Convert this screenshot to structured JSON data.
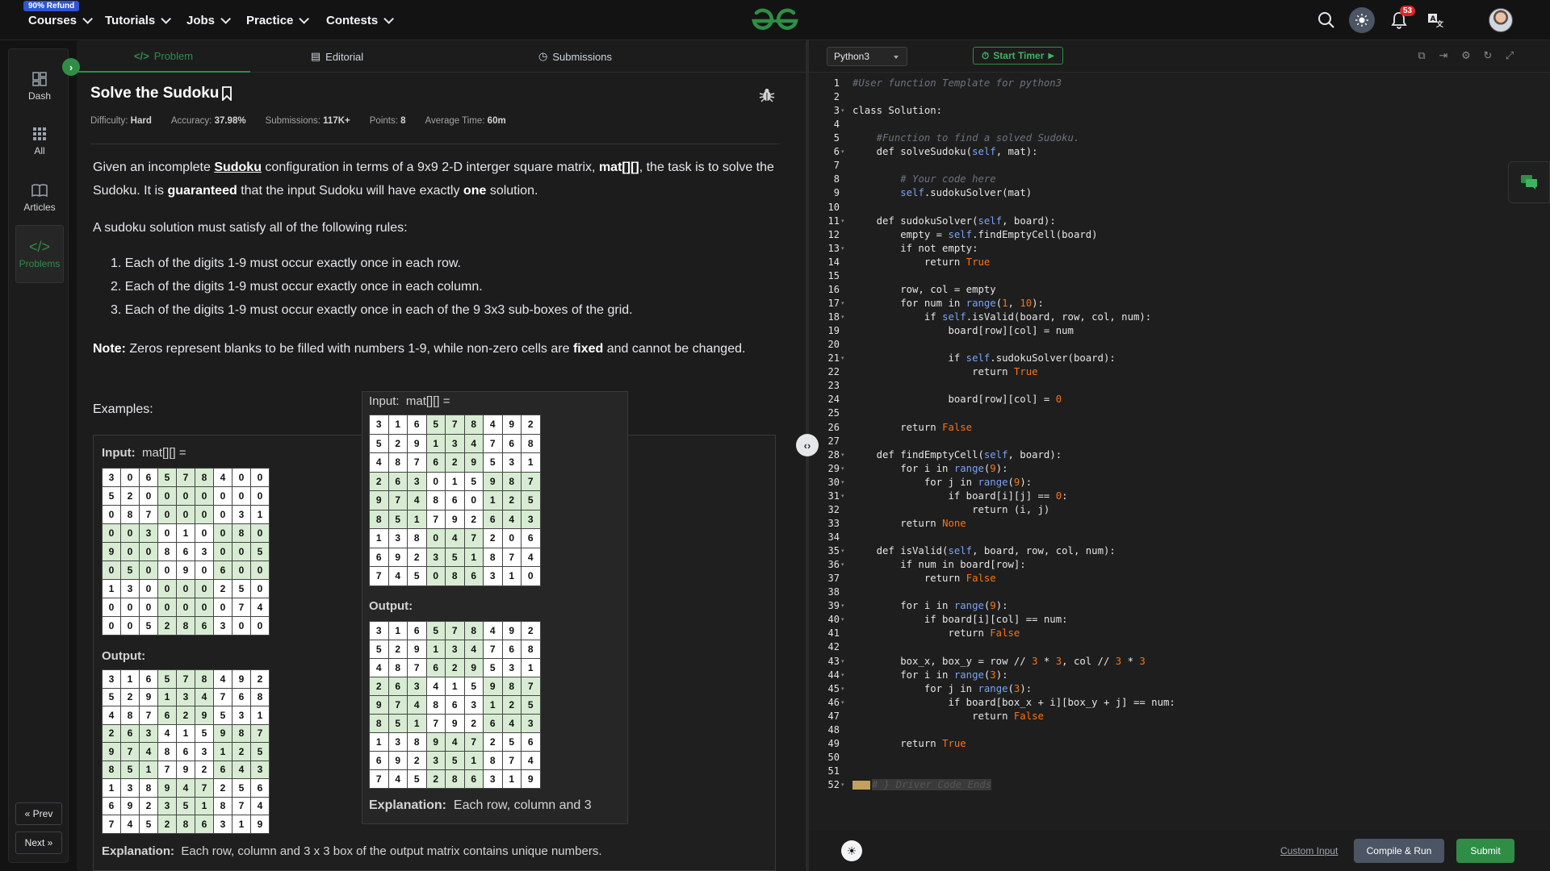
{
  "nav": {
    "refund_badge": "90% Refund",
    "items": [
      "Courses",
      "Tutorials",
      "Jobs",
      "Practice",
      "Contests"
    ],
    "notification_count": "53"
  },
  "sidebar": {
    "items": [
      "Dash",
      "All",
      "Articles",
      "Problems"
    ],
    "prev": "« Prev",
    "next": "Next »"
  },
  "tabs": [
    "Problem",
    "Editorial",
    "Submissions"
  ],
  "problem": {
    "title": "Solve the Sudoku",
    "difficulty_label": "Difficulty:",
    "difficulty": "Hard",
    "accuracy_label": "Accuracy:",
    "accuracy": "37.98%",
    "submissions_label": "Submissions:",
    "submissions": "117K+",
    "points_label": "Points:",
    "points": "8",
    "avgtime_label": "Average Time:",
    "avgtime": "60m",
    "p1_a": "Given an incomplete ",
    "p1_link": "Sudoku",
    "p1_b": " configuration in terms of a 9x9  2-D interger square matrix, ",
    "p1_mat": "mat[][]",
    "p1_c": ", the task is to solve the Sudoku. It is ",
    "p1_guaranteed": "guaranteed",
    "p1_d": " that the input Sudoku will have exactly ",
    "p1_one": "one",
    "p1_e": " solution.",
    "p2": "A sudoku solution must satisfy all of the following rules:",
    "rules": [
      "1. Each of the digits 1-9 must occur exactly once in each row.",
      "2. Each of the digits 1-9 must occur exactly once in each column.",
      "3. Each of the digits 1-9 must occur exactly once in each of the 9 3x3 sub-boxes of the grid."
    ],
    "note_label": "Note:",
    "note_a": " Zeros represent blanks to be filled with numbers 1-9, while non-zero cells are ",
    "note_fixed": "fixed",
    "note_b": " and cannot be changed.",
    "examples": "Examples:",
    "input_label": "Input:",
    "input_var": "mat[][] =",
    "output_label": "Output:",
    "explanation_label": "Explanation:",
    "explanation": "Each row, column and 3 x 3 box of the output matrix contains unique numbers.",
    "explanation_popup": "Each row, column and 3"
  },
  "input_grid": [
    [
      3,
      0,
      6,
      5,
      7,
      8,
      4,
      0,
      0
    ],
    [
      5,
      2,
      0,
      0,
      0,
      0,
      0,
      0,
      0
    ],
    [
      0,
      8,
      7,
      0,
      0,
      0,
      0,
      3,
      1
    ],
    [
      0,
      0,
      3,
      0,
      1,
      0,
      0,
      8,
      0
    ],
    [
      9,
      0,
      0,
      8,
      6,
      3,
      0,
      0,
      5
    ],
    [
      0,
      5,
      0,
      0,
      9,
      0,
      6,
      0,
      0
    ],
    [
      1,
      3,
      0,
      0,
      0,
      0,
      2,
      5,
      0
    ],
    [
      0,
      0,
      0,
      0,
      0,
      0,
      0,
      7,
      4
    ],
    [
      0,
      0,
      5,
      2,
      8,
      6,
      3,
      0,
      0
    ]
  ],
  "output_grid": [
    [
      3,
      1,
      6,
      5,
      7,
      8,
      4,
      9,
      2
    ],
    [
      5,
      2,
      9,
      1,
      3,
      4,
      7,
      6,
      8
    ],
    [
      4,
      8,
      7,
      6,
      2,
      9,
      5,
      3,
      1
    ],
    [
      2,
      6,
      3,
      4,
      1,
      5,
      9,
      8,
      7
    ],
    [
      9,
      7,
      4,
      8,
      6,
      3,
      1,
      2,
      5
    ],
    [
      8,
      5,
      1,
      7,
      9,
      2,
      6,
      4,
      3
    ],
    [
      1,
      3,
      8,
      9,
      4,
      7,
      2,
      5,
      6
    ],
    [
      6,
      9,
      2,
      3,
      5,
      1,
      8,
      7,
      4
    ],
    [
      7,
      4,
      5,
      2,
      8,
      6,
      3,
      1,
      9
    ]
  ],
  "popup_input_grid": [
    [
      3,
      1,
      6,
      5,
      7,
      8,
      4,
      9,
      2
    ],
    [
      5,
      2,
      9,
      1,
      3,
      4,
      7,
      6,
      8
    ],
    [
      4,
      8,
      7,
      6,
      2,
      9,
      5,
      3,
      1
    ],
    [
      2,
      6,
      3,
      0,
      1,
      5,
      9,
      8,
      7
    ],
    [
      9,
      7,
      4,
      8,
      6,
      0,
      1,
      2,
      5
    ],
    [
      8,
      5,
      1,
      7,
      9,
      2,
      6,
      4,
      3
    ],
    [
      1,
      3,
      8,
      0,
      4,
      7,
      2,
      0,
      6
    ],
    [
      6,
      9,
      2,
      3,
      5,
      1,
      8,
      7,
      4
    ],
    [
      7,
      4,
      5,
      0,
      8,
      6,
      3,
      1,
      0
    ]
  ],
  "editor": {
    "language": "Python3",
    "timer": "Start Timer",
    "custom_input": "Custom Input",
    "compile": "Compile & Run",
    "submit": "Submit",
    "lines": [
      "#User function Template for python3",
      "",
      "class Solution:",
      "",
      "    #Function to find a solved Sudoku.",
      "    def solveSudoku(self, mat):",
      "",
      "        # Your code here",
      "        self.sudokuSolver(mat)",
      "",
      "    def sudokuSolver(self, board):",
      "        empty = self.findEmptyCell(board)",
      "        if not empty:",
      "            return True",
      "",
      "        row, col = empty",
      "        for num in range(1, 10):",
      "            if self.isValid(board, row, col, num):",
      "                board[row][col] = num",
      "",
      "                if self.sudokuSolver(board):",
      "                    return True",
      "",
      "                board[row][col] = 0",
      "",
      "        return False",
      "",
      "    def findEmptyCell(self, board):",
      "        for i in range(9):",
      "            for j in range(9):",
      "                if board[i][j] == 0:",
      "                    return (i, j)",
      "        return None",
      "",
      "    def isValid(self, board, row, col, num):",
      "        if num in board[row]:",
      "            return False",
      "",
      "        for i in range(9):",
      "            if board[i][col] == num:",
      "                return False",
      "",
      "        box_x, box_y = row // 3 * 3, col // 3 * 3",
      "        for i in range(3):",
      "            for j in range(3):",
      "                if board[box_x + i][box_y + j] == num:",
      "                    return False",
      "",
      "        return True",
      "",
      "",
      "# } Driver Code Ends"
    ],
    "fold_lines": [
      3,
      6,
      11,
      13,
      17,
      18,
      21,
      28,
      29,
      30,
      31,
      35,
      36,
      39,
      40,
      43,
      44,
      45,
      46,
      52
    ]
  }
}
